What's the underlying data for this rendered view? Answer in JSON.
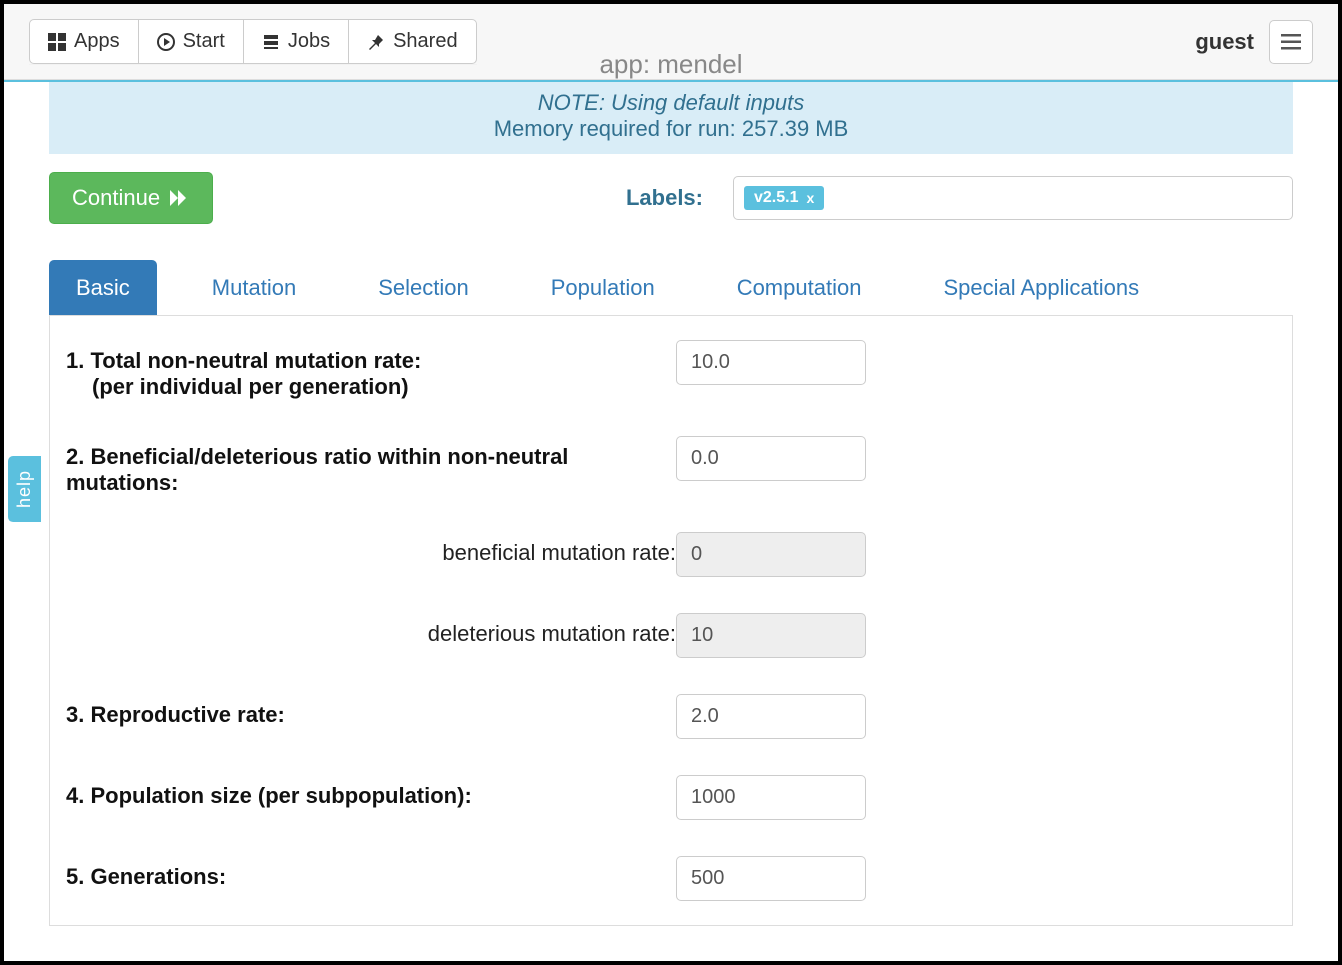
{
  "topbar": {
    "apps": "Apps",
    "start": "Start",
    "jobs": "Jobs",
    "shared": "Shared",
    "app_title": "app: mendel",
    "user": "guest"
  },
  "banner": {
    "note": "NOTE: Using default inputs",
    "memory": "Memory required for run: 257.39 MB"
  },
  "actions": {
    "continue": "Continue",
    "labels_label": "Labels:",
    "tag_value": "v2.5.1",
    "tag_close": "x"
  },
  "tabs": {
    "basic": "Basic",
    "mutation": "Mutation",
    "selection": "Selection",
    "population": "Population",
    "computation": "Computation",
    "special": "Special Applications"
  },
  "form": {
    "f1_label": "1. Total non-neutral mutation rate:",
    "f1_sub": "(per individual per generation)",
    "f1_value": "10.0",
    "f2_label": "2. Beneficial/deleterious ratio within non-neutral mutations:",
    "f2_value": "0.0",
    "f2a_label": "beneficial mutation rate:",
    "f2a_value": "0",
    "f2b_label": "deleterious mutation rate:",
    "f2b_value": "10",
    "f3_label": "3. Reproductive rate:",
    "f3_value": "2.0",
    "f4_label": "4. Population size (per subpopulation):",
    "f4_value": "1000",
    "f5_label": "5. Generations:",
    "f5_value": "500"
  },
  "help": "help"
}
